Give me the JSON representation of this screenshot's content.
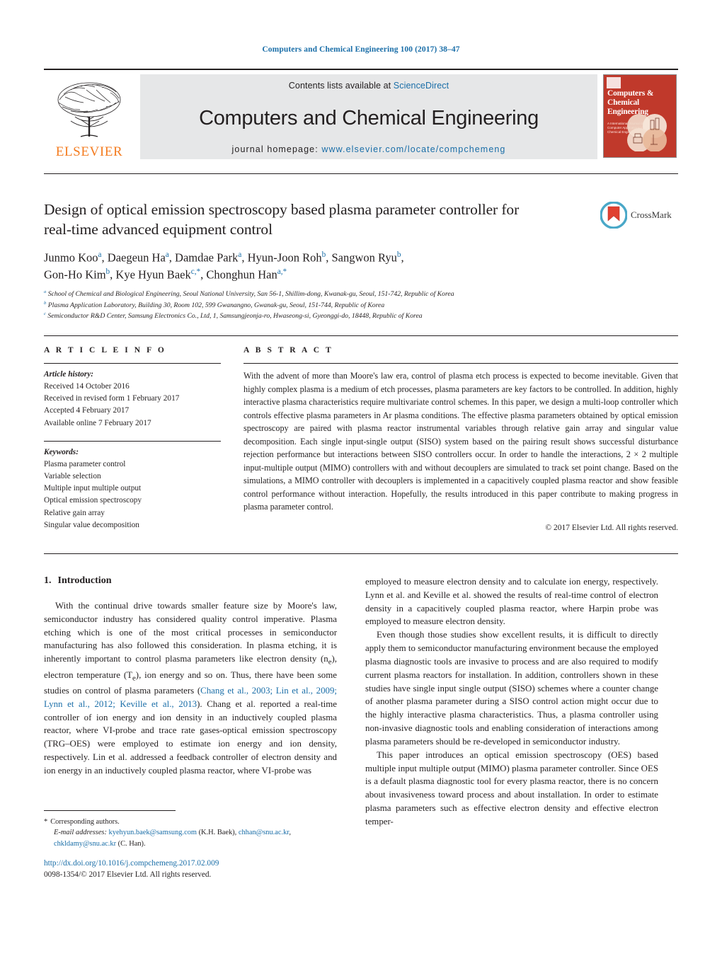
{
  "running_head": "Computers and Chemical Engineering 100 (2017) 38–47",
  "masthead": {
    "publisher_logo_name": "elsevier-tree-logo",
    "publisher_wordmark": "ELSEVIER",
    "contents_prefix": "Contents lists available at ",
    "contents_link": "ScienceDirect",
    "journal_name": "Computers and Chemical Engineering",
    "homepage_prefix": "journal homepage: ",
    "homepage_url": "www.elsevier.com/locate/compchemeng",
    "cover": {
      "title": "Computers & Chemical Engineering",
      "subtitle": "A International Journal of Computer Applications in Chemical Engineering"
    }
  },
  "article": {
    "title": "Design of optical emission spectroscopy based plasma parameter controller for real-time advanced equipment control",
    "crossmark_label": "CrossMark",
    "authors_line1": "Junmo Koo<sup>a</sup>, Daegeun Ha<sup>a</sup>, Damdae Park<sup>a</sup>, Hyun-Joon Roh<sup>b</sup>, Sangwon Ryu<sup>b</sup>,",
    "authors_line2": "Gon-Ho Kim<sup>b</sup>, Kye Hyun Baek<sup>c,*</sup>, Chonghun Han<sup>a,*</sup>",
    "affiliations": [
      "<sup>a</sup> School of Chemical and Biological Engineering, Seoul National University, San 56-1, Shillim-dong, Kwanak-gu, Seoul, 151-742, Republic of Korea",
      "<sup>b</sup> Plasma Application Laboratory, Building 30, Room 102, 599 Gwanangno, Gwanak-gu, Seoul, 151-744, Republic of Korea",
      "<sup>c</sup> Semiconductor R&amp;D Center, Samsung Electronics Co., Ltd, 1, Samsungjeonja-ro, Hwaseong-si, Gyeonggi-do, 18448, Republic of Korea"
    ]
  },
  "article_info": {
    "heading": "A R T I C L E  I N F O",
    "history_label": "Article history:",
    "history": [
      "Received 14 October 2016",
      "Received in revised form 1 February 2017",
      "Accepted 4 February 2017",
      "Available online 7 February 2017"
    ],
    "keywords_label": "Keywords:",
    "keywords": [
      "Plasma parameter control",
      "Variable selection",
      "Multiple input multiple output",
      "Optical emission spectroscopy",
      "Relative gain array",
      "Singular value decomposition"
    ]
  },
  "abstract": {
    "heading": "A B S T R A C T",
    "text": "With the advent of more than Moore's law era, control of plasma etch process is expected to become inevitable. Given that highly complex plasma is a medium of etch processes, plasma parameters are key factors to be controlled. In addition, highly interactive plasma characteristics require multivariate control schemes. In this paper, we design a multi-loop controller which controls effective plasma parameters in Ar plasma conditions. The effective plasma parameters obtained by optical emission spectroscopy are paired with plasma reactor instrumental variables through relative gain array and singular value decomposition. Each single input-single output (SISO) system based on the pairing result shows successful disturbance rejection performance but interactions between SISO controllers occur. In order to handle the interactions, 2 × 2 multiple input-multiple output (MIMO) controllers with and without decouplers are simulated to track set point change. Based on the simulations, a MIMO controller with decouplers is implemented in a capacitively coupled plasma reactor and show feasible control performance without interaction. Hopefully, the results introduced in this paper contribute to making progress in plasma parameter control.",
    "copyright": "© 2017 Elsevier Ltd. All rights reserved."
  },
  "body": {
    "section_number": "1.",
    "section_title": "Introduction",
    "left_paragraphs": [
      "With the continual drive towards smaller feature size by Moore's law, semiconductor industry has considered quality control imperative. Plasma etching which is one of the most critical processes in semiconductor manufacturing has also followed this consideration. In plasma etching, it is inherently important to control plasma parameters like electron density (n<sub>e</sub>), electron temperature (T<sub>e</sub>), ion energy and so on. Thus, there have been some studies on control of plasma parameters (<span class=\"cite\">Chang et al., 2003; Lin et al., 2009; Lynn et al., 2012; Keville et al., 2013</span>). Chang et al. reported a real-time controller of ion energy and ion density in an inductively coupled plasma reactor, where VI-probe and trace rate gases-optical emission spectroscopy (TRG–OES) were employed to estimate ion energy and ion density, respectively. Lin et al. addressed a feedback controller of electron density and ion energy in an inductively coupled plasma reactor, where VI-probe was"
    ],
    "right_paragraphs": [
      "employed to measure electron density and to calculate ion energy, respectively. Lynn et al. and Keville et al. showed the results of real-time control of electron density in a capacitively coupled plasma reactor, where Harpin probe was employed to measure electron density.",
      "Even though those studies show excellent results, it is difficult to directly apply them to semiconductor manufacturing environment because the employed plasma diagnostic tools are invasive to process and are also required to modify current plasma reactors for installation. In addition, controllers shown in these studies have single input single output (SISO) schemes where a counter change of another plasma parameter during a SISO control action might occur due to the highly interactive plasma characteristics. Thus, a plasma controller using non-invasive diagnostic tools and enabling consideration of interactions among plasma parameters should be re-developed in semiconductor industry.",
      "This paper introduces an optical emission spectroscopy (OES) based multiple input multiple output (MIMO) plasma parameter controller. Since OES is a default plasma diagnostic tool for every plasma reactor, there is no concern about invasiveness toward process and about installation. In order to estimate plasma parameters such as effective electron density and effective electron temper-"
    ]
  },
  "footnote": {
    "corresponding": "Corresponding authors.",
    "email_label": "E-mail addresses:",
    "email_text": "<span class=\"mail\">kyehyun.baek@samsung.com</span> (K.H. Baek), <span class=\"mail\">chhan@snu.ac.kr</span>, <span class=\"mail\">chkldamy@snu.ac.kr</span> (C. Han)."
  },
  "footer": {
    "doi": "http://dx.doi.org/10.1016/j.compchemeng.2017.02.009",
    "issn": "0098-1354/© 2017 Elsevier Ltd. All rights reserved."
  },
  "colors": {
    "link_blue": "#1a6ea8",
    "elsevier_orange": "#f47c20",
    "cover_red": "#c0392b",
    "band_gray": "#e6e7e8"
  }
}
